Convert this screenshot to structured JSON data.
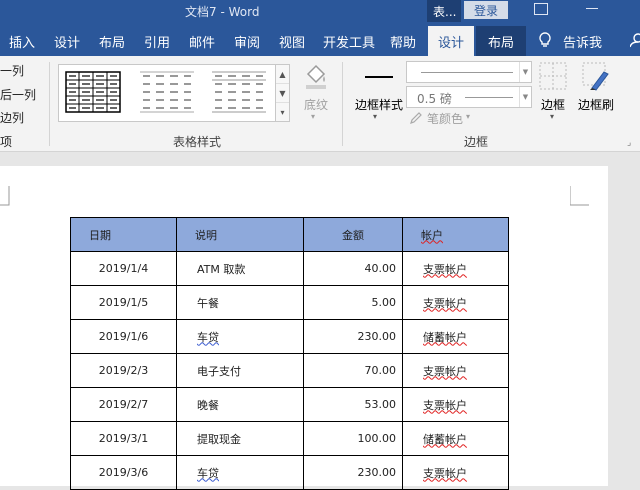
{
  "window": {
    "title": "文档7  -  Word",
    "context_tab": "表...",
    "login_button": "登录"
  },
  "ribbon_tabs": [
    "插入",
    "设计",
    "布局",
    "引用",
    "邮件",
    "审阅",
    "视图",
    "开发工具",
    "帮助"
  ],
  "active_tab": "设计",
  "context_layout_tab": "布局",
  "tell_me": "告诉我",
  "ribbon": {
    "left_options": [
      "一列",
      "后一列",
      "边列",
      "项"
    ],
    "table_styles_group": "表格样式",
    "shading_button": "底纹",
    "border_styles_button": "边框样式",
    "line_weight": "0.5 磅",
    "pen_color": "笔颜色",
    "borders_button": "边框",
    "border_painter_button": "边框刷",
    "borders_group": "边框"
  },
  "table": {
    "headers": [
      "日期",
      "说明",
      "金额",
      "帐户"
    ],
    "rows": [
      {
        "date": "2019/1/4",
        "desc": "ATM  取款",
        "amount": "40.00",
        "account": "支票帐户"
      },
      {
        "date": "2019/1/5",
        "desc": "午餐",
        "amount": "5.00",
        "account": "支票帐户"
      },
      {
        "date": "2019/1/6",
        "desc": "车贷",
        "amount": "230.00",
        "account": "储蓄帐户"
      },
      {
        "date": "2019/2/3",
        "desc": "电子支付",
        "amount": "70.00",
        "account": "支票帐户"
      },
      {
        "date": "2019/2/7",
        "desc": "晚餐",
        "amount": "53.00",
        "account": "支票帐户"
      },
      {
        "date": "2019/3/1",
        "desc": "提取现金",
        "amount": "100.00",
        "account": "储蓄帐户"
      },
      {
        "date": "2019/3/6",
        "desc": "车贷",
        "amount": "230.00",
        "account": "支票帐户"
      }
    ]
  },
  "colors": {
    "title_bar": "#2b579a",
    "header_fill": "#8ea9db",
    "context_tab": "#1e3f73"
  }
}
